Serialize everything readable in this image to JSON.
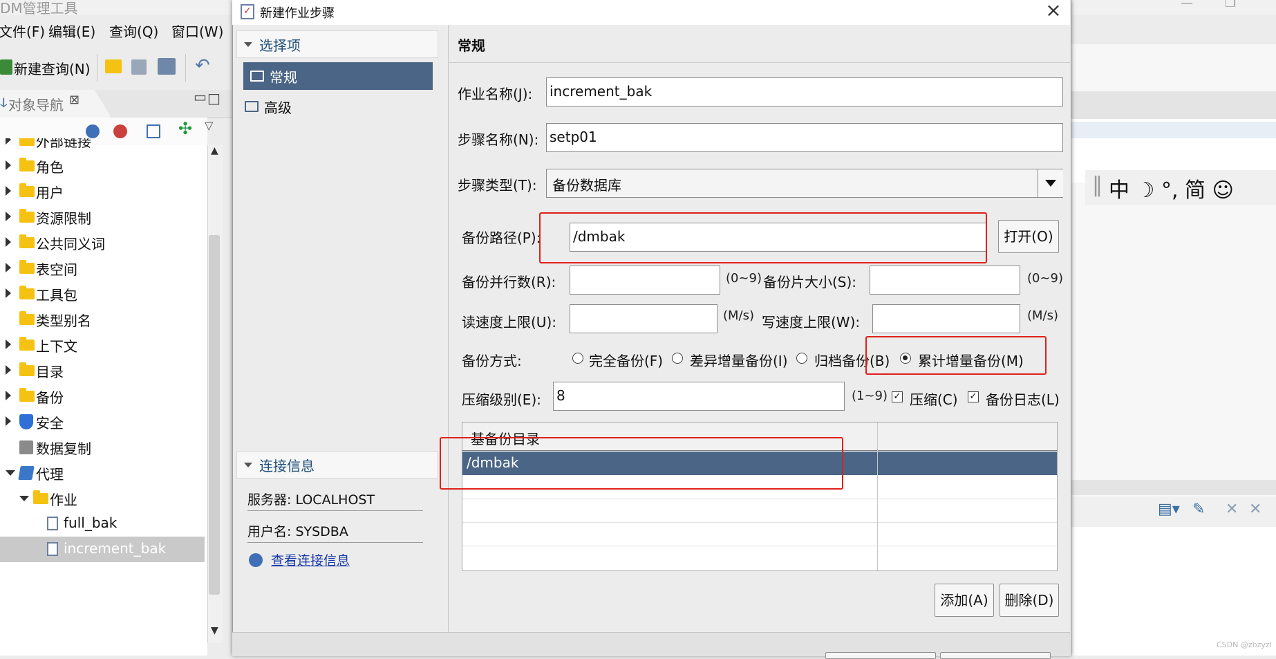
{
  "app": {
    "title": "DM管理工具",
    "menu": [
      "文件(F)",
      "编辑(E)",
      "查询(Q)",
      "窗口(W)"
    ],
    "toolbar_new_query": "新建查询(N)"
  },
  "nav": {
    "tab_label": "对象导航",
    "tree": [
      {
        "label": "外部链接",
        "type": "folder",
        "expand": "closed",
        "indent": 0
      },
      {
        "label": "角色",
        "type": "folder",
        "expand": "closed",
        "indent": 0
      },
      {
        "label": "用户",
        "type": "folder",
        "expand": "closed",
        "indent": 0
      },
      {
        "label": "资源限制",
        "type": "folder",
        "expand": "closed",
        "indent": 0
      },
      {
        "label": "公共同义词",
        "type": "folder",
        "expand": "closed",
        "indent": 0
      },
      {
        "label": "表空间",
        "type": "folder",
        "expand": "closed",
        "indent": 0
      },
      {
        "label": "工具包",
        "type": "folder",
        "expand": "closed",
        "indent": 0
      },
      {
        "label": "类型别名",
        "type": "folder",
        "expand": "none",
        "indent": 0
      },
      {
        "label": "上下文",
        "type": "folder",
        "expand": "closed",
        "indent": 0
      },
      {
        "label": "目录",
        "type": "folder",
        "expand": "closed",
        "indent": 0
      },
      {
        "label": "备份",
        "type": "folder",
        "expand": "closed",
        "indent": 0
      },
      {
        "label": "安全",
        "type": "shield",
        "expand": "closed",
        "indent": 0
      },
      {
        "label": "数据复制",
        "type": "replicate",
        "expand": "none",
        "indent": 0
      },
      {
        "label": "代理",
        "type": "agent",
        "expand": "open",
        "indent": 0
      },
      {
        "label": "作业",
        "type": "folder",
        "expand": "open",
        "indent": 1
      },
      {
        "label": "full_bak",
        "type": "job",
        "expand": "none",
        "indent": 2
      },
      {
        "label": "increment_bak",
        "type": "job",
        "expand": "none",
        "indent": 2,
        "selected": true
      }
    ]
  },
  "ime": {
    "text": "中 ☽ °, 简 ☺"
  },
  "dialog": {
    "title": "新建作业步骤",
    "close": "×",
    "options_header": "选择项",
    "options": [
      {
        "label": "常规",
        "selected": true
      },
      {
        "label": "高级",
        "selected": false
      }
    ],
    "conn_header": "连接信息",
    "server": "服务器: LOCALHOST",
    "user": "用户名: SYSDBA",
    "view_conn": "查看连接信息",
    "pane_title": "常规",
    "job_name_label": "作业名称(J):",
    "job_name_value": "increment_bak",
    "step_name_label": "步骤名称(N):",
    "step_name_value": "setp01",
    "step_type_label": "步骤类型(T):",
    "step_type_value": "备份数据库",
    "backup_path_label": "备份路径(P):",
    "backup_path_value": "/dmbak",
    "open_button": "打开(O)",
    "parallel_label": "备份并行数(R):",
    "parallel_value": "",
    "parallel_range": "(0~9)",
    "piece_label": "备份片大小(S):",
    "piece_value": "",
    "piece_range": "(0~9)",
    "read_speed_label": "读速度上限(U):",
    "read_speed_value": "",
    "read_unit": "(M/s)",
    "write_speed_label": "写速度上限(W):",
    "write_speed_value": "",
    "write_unit": "(M/s)",
    "backup_mode_label": "备份方式:",
    "modes": [
      {
        "label": "完全备份(F)",
        "selected": false
      },
      {
        "label": "差异增量备份(I)",
        "selected": false
      },
      {
        "label": "归档备份(B)",
        "selected": false
      },
      {
        "label": "累计增量备份(M)",
        "selected": true
      }
    ],
    "compress_level_label": "压缩级别(E):",
    "compress_level_value": "8",
    "compress_range": "(1~9)",
    "compress_check": "压缩(C)",
    "compress_checked": true,
    "log_check": "备份日志(L)",
    "log_checked": true,
    "grid_header": "基备份目录",
    "grid_rows": [
      "/dmbak"
    ],
    "add_button": "添加(A)",
    "delete_button": "删除(D)"
  },
  "colors": {
    "selection": "#4a6585",
    "annotation": "#e0201a",
    "folder": "#f5c211"
  },
  "watermark": "CSDN @zbzyzl"
}
